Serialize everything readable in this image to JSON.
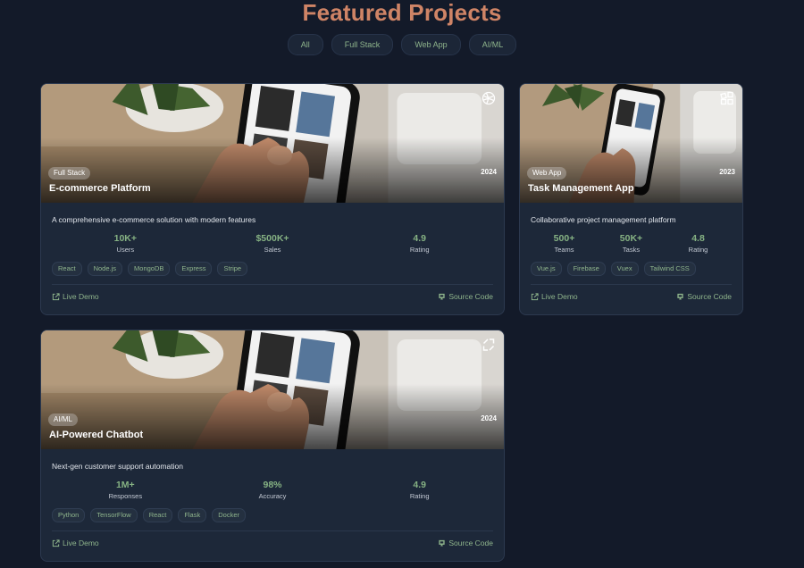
{
  "page": {
    "title": "Featured Projects"
  },
  "filters": [
    "All",
    "Full Stack",
    "Web App",
    "AI/ML"
  ],
  "colors": {
    "accent": "#cf8466",
    "green": "#86b283",
    "background": "#131a29",
    "card": "#1d2839"
  },
  "projects": [
    {
      "category": "Full Stack",
      "year": "2024",
      "title": "E-commerce Platform",
      "description": "A comprehensive e-commerce solution with modern features",
      "corner_icon": "globe-icon",
      "stats": [
        {
          "value": "10K+",
          "label": "Users"
        },
        {
          "value": "$500K+",
          "label": "Sales"
        },
        {
          "value": "4.9",
          "label": "Rating"
        }
      ],
      "tags": [
        "React",
        "Node.js",
        "MongoDB",
        "Express",
        "Stripe"
      ],
      "live_demo": "Live Demo",
      "source_code": "Source Code"
    },
    {
      "category": "Web App",
      "year": "2023",
      "title": "Task Management App",
      "description": "Collaborative project management platform",
      "corner_icon": "grid-icon",
      "stats": [
        {
          "value": "500+",
          "label": "Teams"
        },
        {
          "value": "50K+",
          "label": "Tasks"
        },
        {
          "value": "4.8",
          "label": "Rating"
        }
      ],
      "tags": [
        "Vue.js",
        "Firebase",
        "Vuex",
        "Tailwind CSS"
      ],
      "live_demo": "Live Demo",
      "source_code": "Source Code"
    },
    {
      "category": "AI/ML",
      "year": "2024",
      "title": "AI-Powered Chatbot",
      "description": "Next-gen customer support automation",
      "corner_icon": "expand-icon",
      "stats": [
        {
          "value": "1M+",
          "label": "Responses"
        },
        {
          "value": "98%",
          "label": "Accuracy"
        },
        {
          "value": "4.9",
          "label": "Rating"
        }
      ],
      "tags": [
        "Python",
        "TensorFlow",
        "React",
        "Flask",
        "Docker"
      ],
      "live_demo": "Live Demo",
      "source_code": "Source Code"
    }
  ]
}
